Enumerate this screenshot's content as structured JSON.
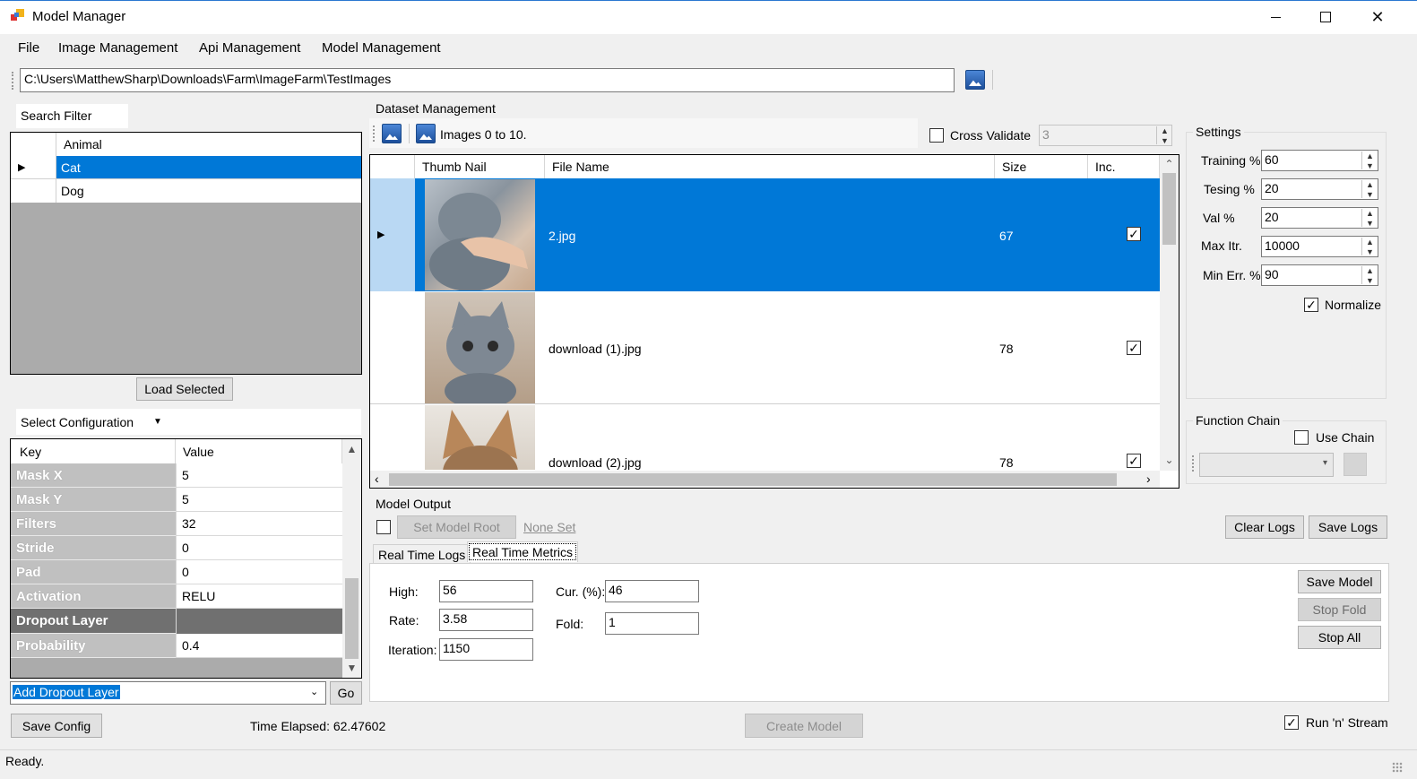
{
  "window": {
    "title": "Model Manager",
    "controls": {
      "minimize": "—",
      "maximize": "☐",
      "close": "✕"
    }
  },
  "menu": {
    "items": [
      "File",
      "Image Management",
      "Api Management",
      "Model Management"
    ]
  },
  "path_bar": {
    "value": "C:\\Users\\MatthewSharp\\Downloads\\Farm\\ImageFarm\\TestImages"
  },
  "search_filter": {
    "title": "Search Filter",
    "column": "Animal",
    "rows": [
      {
        "label": "Cat",
        "selected": true
      },
      {
        "label": "Dog",
        "selected": false
      }
    ],
    "load_button": "Load Selected"
  },
  "config": {
    "select_label": "Select Configuration",
    "headers": {
      "key": "Key",
      "value": "Value"
    },
    "rows": [
      {
        "key": "Mask X",
        "value": "5"
      },
      {
        "key": "Mask Y",
        "value": "5"
      },
      {
        "key": "Filters",
        "value": "32"
      },
      {
        "key": "Stride",
        "value": "0"
      },
      {
        "key": "Pad",
        "value": "0"
      },
      {
        "key": "Activation",
        "value": "RELU"
      },
      {
        "key": "Dropout Layer",
        "value": "",
        "section": true
      },
      {
        "key": "Probability",
        "value": "0.4"
      }
    ],
    "layer_select": "Add Dropout Layer",
    "go_button": "Go",
    "save_button": "Save Config"
  },
  "dataset": {
    "title": "Dataset Management",
    "images_label": "Images 0 to 10.",
    "cross_validate_label": "Cross Validate",
    "cross_validate_checked": false,
    "folds_value": "3",
    "headers": {
      "thumb": "Thumb Nail",
      "file": "File Name",
      "size": "Size",
      "inc": "Inc."
    },
    "rows": [
      {
        "file": "2.jpg",
        "size": "67",
        "inc": true,
        "selected": true
      },
      {
        "file": "download (1).jpg",
        "size": "78",
        "inc": true,
        "selected": false
      },
      {
        "file": "download (2).jpg",
        "size": "78",
        "inc": true,
        "selected": false
      }
    ]
  },
  "settings": {
    "title": "Settings",
    "fields": [
      {
        "label": "Training %",
        "value": "60"
      },
      {
        "label": "Tesing %",
        "value": "20"
      },
      {
        "label": "Val %",
        "value": "20"
      },
      {
        "label": "Max Itr.",
        "value": "10000"
      },
      {
        "label": "Min Err. %",
        "value": "90"
      }
    ],
    "normalize_label": "Normalize",
    "normalize_checked": true
  },
  "function_chain": {
    "title": "Function Chain",
    "use_chain_label": "Use Chain",
    "use_chain_checked": false
  },
  "model_output": {
    "title": "Model Output",
    "set_root_button": "Set Model Root",
    "none_set": "None Set",
    "clear_logs": "Clear Logs",
    "save_logs": "Save Logs",
    "tabs": [
      "Real Time Logs",
      "Real Time Metrics"
    ],
    "active_tab": 1,
    "metrics": {
      "high_label": "High:",
      "high": "56",
      "rate_label": "Rate:",
      "rate": "3.58",
      "iteration_label": "Iteration:",
      "iteration": "1150",
      "cur_label": "Cur. (%):",
      "cur": "46",
      "fold_label": "Fold:",
      "fold": "1"
    },
    "save_model": "Save Model",
    "stop_fold": "Stop Fold",
    "stop_all": "Stop All"
  },
  "footer": {
    "time_elapsed": "Time Elapsed: 62.47602",
    "create_model": "Create Model",
    "run_stream_label": "Run 'n' Stream",
    "run_stream_checked": true,
    "status": "Ready."
  },
  "colors": {
    "selection": "#0078d7",
    "grid_bg": "#ababab",
    "key_bg": "#c0c0c0",
    "section_bg": "#707070"
  }
}
